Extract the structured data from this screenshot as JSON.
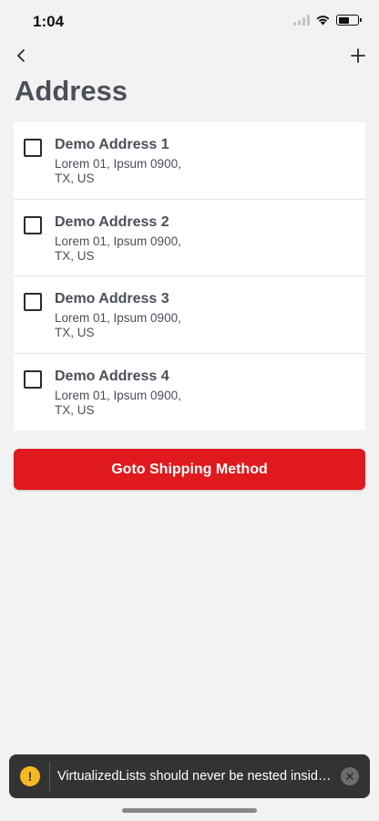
{
  "status_bar": {
    "time": "1:04",
    "battery_level": 0.55
  },
  "header": {
    "title": "Address",
    "back_icon": "chevron-left-icon",
    "add_icon": "plus-icon"
  },
  "addresses": [
    {
      "name": "Demo Address 1",
      "line1": "Lorem 01, Ipsum 0900,",
      "line2": "TX, US",
      "checked": false
    },
    {
      "name": "Demo Address 2",
      "line1": "Lorem 01, Ipsum 0900,",
      "line2": "TX, US",
      "checked": false
    },
    {
      "name": "Demo Address 3",
      "line1": "Lorem 01, Ipsum 0900,",
      "line2": "TX, US",
      "checked": false
    },
    {
      "name": "Demo Address 4",
      "line1": "Lorem 01, Ipsum 0900,",
      "line2": "TX, US",
      "checked": false
    }
  ],
  "primary_button": {
    "label": "Goto Shipping Method",
    "color": "#e0191e"
  },
  "warning_toast": {
    "text": "VirtualizedLists should never be nested inside plain ScrollViews with the same orientation",
    "icon_glyph": "!",
    "icon_color": "#f5b921"
  }
}
